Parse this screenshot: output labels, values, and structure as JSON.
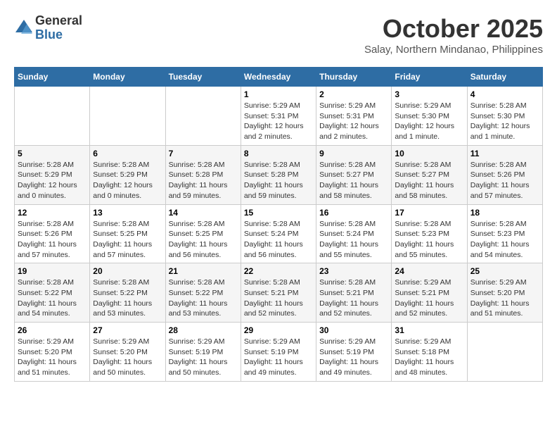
{
  "header": {
    "logo_line1": "General",
    "logo_line2": "Blue",
    "month": "October 2025",
    "location": "Salay, Northern Mindanao, Philippines"
  },
  "weekdays": [
    "Sunday",
    "Monday",
    "Tuesday",
    "Wednesday",
    "Thursday",
    "Friday",
    "Saturday"
  ],
  "weeks": [
    [
      {
        "day": "",
        "info": ""
      },
      {
        "day": "",
        "info": ""
      },
      {
        "day": "",
        "info": ""
      },
      {
        "day": "1",
        "info": "Sunrise: 5:29 AM\nSunset: 5:31 PM\nDaylight: 12 hours and 2 minutes."
      },
      {
        "day": "2",
        "info": "Sunrise: 5:29 AM\nSunset: 5:31 PM\nDaylight: 12 hours and 2 minutes."
      },
      {
        "day": "3",
        "info": "Sunrise: 5:29 AM\nSunset: 5:30 PM\nDaylight: 12 hours and 1 minute."
      },
      {
        "day": "4",
        "info": "Sunrise: 5:28 AM\nSunset: 5:30 PM\nDaylight: 12 hours and 1 minute."
      }
    ],
    [
      {
        "day": "5",
        "info": "Sunrise: 5:28 AM\nSunset: 5:29 PM\nDaylight: 12 hours and 0 minutes."
      },
      {
        "day": "6",
        "info": "Sunrise: 5:28 AM\nSunset: 5:29 PM\nDaylight: 12 hours and 0 minutes."
      },
      {
        "day": "7",
        "info": "Sunrise: 5:28 AM\nSunset: 5:28 PM\nDaylight: 11 hours and 59 minutes."
      },
      {
        "day": "8",
        "info": "Sunrise: 5:28 AM\nSunset: 5:28 PM\nDaylight: 11 hours and 59 minutes."
      },
      {
        "day": "9",
        "info": "Sunrise: 5:28 AM\nSunset: 5:27 PM\nDaylight: 11 hours and 58 minutes."
      },
      {
        "day": "10",
        "info": "Sunrise: 5:28 AM\nSunset: 5:27 PM\nDaylight: 11 hours and 58 minutes."
      },
      {
        "day": "11",
        "info": "Sunrise: 5:28 AM\nSunset: 5:26 PM\nDaylight: 11 hours and 57 minutes."
      }
    ],
    [
      {
        "day": "12",
        "info": "Sunrise: 5:28 AM\nSunset: 5:26 PM\nDaylight: 11 hours and 57 minutes."
      },
      {
        "day": "13",
        "info": "Sunrise: 5:28 AM\nSunset: 5:25 PM\nDaylight: 11 hours and 57 minutes."
      },
      {
        "day": "14",
        "info": "Sunrise: 5:28 AM\nSunset: 5:25 PM\nDaylight: 11 hours and 56 minutes."
      },
      {
        "day": "15",
        "info": "Sunrise: 5:28 AM\nSunset: 5:24 PM\nDaylight: 11 hours and 56 minutes."
      },
      {
        "day": "16",
        "info": "Sunrise: 5:28 AM\nSunset: 5:24 PM\nDaylight: 11 hours and 55 minutes."
      },
      {
        "day": "17",
        "info": "Sunrise: 5:28 AM\nSunset: 5:23 PM\nDaylight: 11 hours and 55 minutes."
      },
      {
        "day": "18",
        "info": "Sunrise: 5:28 AM\nSunset: 5:23 PM\nDaylight: 11 hours and 54 minutes."
      }
    ],
    [
      {
        "day": "19",
        "info": "Sunrise: 5:28 AM\nSunset: 5:22 PM\nDaylight: 11 hours and 54 minutes."
      },
      {
        "day": "20",
        "info": "Sunrise: 5:28 AM\nSunset: 5:22 PM\nDaylight: 11 hours and 53 minutes."
      },
      {
        "day": "21",
        "info": "Sunrise: 5:28 AM\nSunset: 5:22 PM\nDaylight: 11 hours and 53 minutes."
      },
      {
        "day": "22",
        "info": "Sunrise: 5:28 AM\nSunset: 5:21 PM\nDaylight: 11 hours and 52 minutes."
      },
      {
        "day": "23",
        "info": "Sunrise: 5:28 AM\nSunset: 5:21 PM\nDaylight: 11 hours and 52 minutes."
      },
      {
        "day": "24",
        "info": "Sunrise: 5:29 AM\nSunset: 5:21 PM\nDaylight: 11 hours and 52 minutes."
      },
      {
        "day": "25",
        "info": "Sunrise: 5:29 AM\nSunset: 5:20 PM\nDaylight: 11 hours and 51 minutes."
      }
    ],
    [
      {
        "day": "26",
        "info": "Sunrise: 5:29 AM\nSunset: 5:20 PM\nDaylight: 11 hours and 51 minutes."
      },
      {
        "day": "27",
        "info": "Sunrise: 5:29 AM\nSunset: 5:20 PM\nDaylight: 11 hours and 50 minutes."
      },
      {
        "day": "28",
        "info": "Sunrise: 5:29 AM\nSunset: 5:19 PM\nDaylight: 11 hours and 50 minutes."
      },
      {
        "day": "29",
        "info": "Sunrise: 5:29 AM\nSunset: 5:19 PM\nDaylight: 11 hours and 49 minutes."
      },
      {
        "day": "30",
        "info": "Sunrise: 5:29 AM\nSunset: 5:19 PM\nDaylight: 11 hours and 49 minutes."
      },
      {
        "day": "31",
        "info": "Sunrise: 5:29 AM\nSunset: 5:18 PM\nDaylight: 11 hours and 48 minutes."
      },
      {
        "day": "",
        "info": ""
      }
    ]
  ]
}
